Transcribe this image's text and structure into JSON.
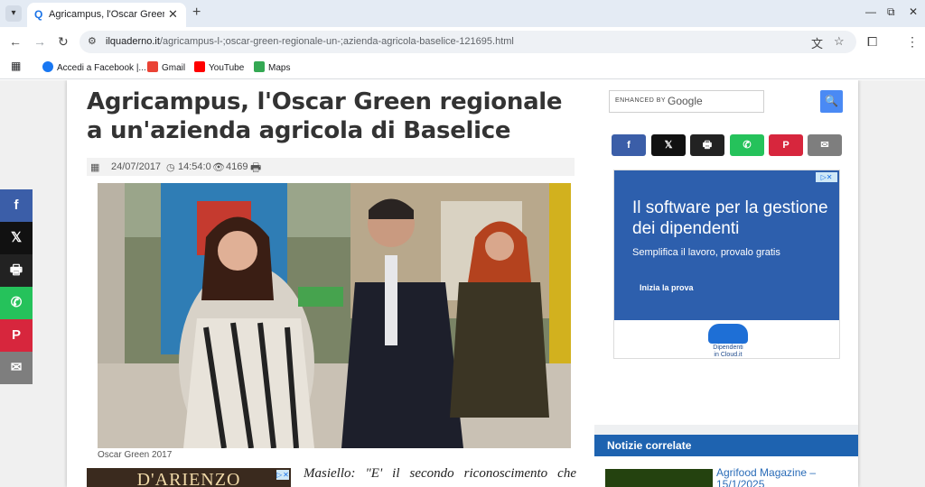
{
  "browser": {
    "tab_title": "Agricampus, l'Oscar Green regionale a un'azienda agricola di Baselice",
    "url_host": "ilquaderno.it",
    "url_path": "/agricampus-l-;oscar-green-regionale-un-;azienda-agricola-baselice-121695.html",
    "bookmarks": [
      {
        "label": "Accedi a Facebook |..."
      },
      {
        "label": "Gmail"
      },
      {
        "label": "YouTube"
      },
      {
        "label": "Maps"
      }
    ],
    "icons": [
      "chevron-down-icon",
      "close-icon",
      "plus-icon",
      "minimize-icon",
      "restore-icon",
      "close-window-icon",
      "back-icon",
      "forward-icon",
      "reload-icon",
      "site-info-icon",
      "translate-icon",
      "star-icon",
      "extensions-icon",
      "kebab-menu-icon",
      "apps-icon"
    ]
  },
  "article": {
    "headline": "Agricampus, l'Oscar Green regionale a un'azienda agricola di Baselice",
    "date": "24/07/2017",
    "time": "14:54:0",
    "views": "4169",
    "photo_caption": "Oscar Green 2017",
    "lead": "Masiello: \"E' il secondo riconoscimento che arriva dalla medio ...e a del...r..."
  },
  "ads": {
    "small_ad_text": "D'ARIENZO",
    "big_ad_title": "Il software per la gestione dei dipendenti",
    "big_ad_sub": "Semplifica il lavoro, provalo gratis",
    "big_ad_cta": "Inizia la prova",
    "big_ad_logo_line1": "Dipendenti",
    "big_ad_logo_line2": "in Cloud.it"
  },
  "sidebar": {
    "search_enhanced": "ENHANCED BY",
    "search_brand": "Google",
    "related_title": "Notizie correlate",
    "related_link": "Agrifood Magazine – 15/1/2025"
  },
  "colors": {
    "facebook": "#3b5ea8",
    "x": "#111111",
    "print": "#222222",
    "whatsapp": "#25c25b",
    "pinterest": "#d7263d",
    "email": "#7e7e7e"
  }
}
